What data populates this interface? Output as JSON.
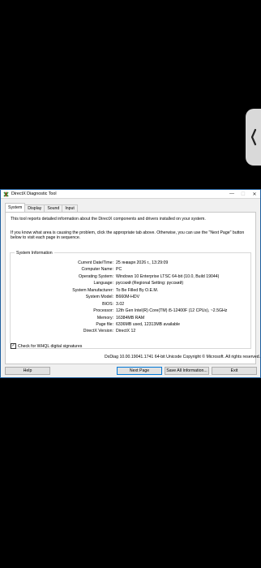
{
  "window": {
    "title": "DirectX Diagnostic Tool",
    "caption": {
      "minimize": "—",
      "maximize": "☐",
      "close": "✕"
    }
  },
  "tabs": [
    "System",
    "Display",
    "Sound",
    "Input"
  ],
  "active_tab": "System",
  "intro": {
    "line1": "This tool reports detailed information about the DirectX components and drivers installed on your system.",
    "line2": "If you know what area is causing the problem, click the appropriate tab above.  Otherwise, you can use the \"Next Page\" button below to visit each page in sequence."
  },
  "system_info": {
    "group_title": "System Information",
    "rows": [
      {
        "label": "Current Date/Time:",
        "value": "25 января 2026 г., 13:29:09"
      },
      {
        "label": "Computer Name:",
        "value": "PC"
      },
      {
        "label": "Operating System:",
        "value": "Windows 10 Enterprise LTSC 64-bit (10.0, Build 19044)"
      },
      {
        "label": "Language:",
        "value": "русский (Regional Setting: русский)"
      },
      {
        "label": "System Manufacturer:",
        "value": "To Be Filled By O.E.M."
      },
      {
        "label": "System Model:",
        "value": "B660M-HDV"
      },
      {
        "label": "BIOS:",
        "value": "3.02"
      },
      {
        "label": "Processor:",
        "value": "12th Gen Intel(R) Core(TM) i5-12400F (12 CPUs), ~2.5GHz"
      },
      {
        "label": "Memory:",
        "value": "16384MB RAM"
      },
      {
        "label": "Page file:",
        "value": "6336MB used, 12313MB available"
      },
      {
        "label": "DirectX Version:",
        "value": "DirectX 12"
      }
    ]
  },
  "whql": {
    "label": "Check for WHQL digital signatures",
    "checked": true
  },
  "copyright": "DxDiag 10.00.19041.1741 64-bit Unicode  Copyright © Microsoft. All rights reserved.",
  "buttons": {
    "help": "Help",
    "next": "Next Page",
    "save": "Save All Information...",
    "exit": "Exit"
  },
  "colors": {
    "accent": "#0078d7",
    "side_handle": "#d9d9d9"
  },
  "icons": {
    "side_handle": "chevron-left-icon",
    "app": "directx-app-icon"
  }
}
